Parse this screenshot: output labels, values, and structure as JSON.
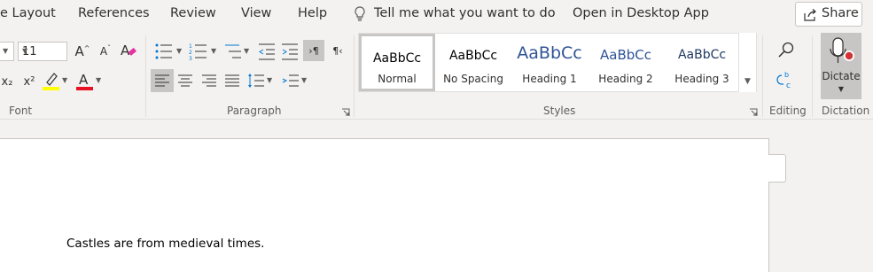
{
  "menu": {
    "items": [
      {
        "label": "e Layout"
      },
      {
        "label": "References"
      },
      {
        "label": "Review"
      },
      {
        "label": "View"
      },
      {
        "label": "Help"
      }
    ],
    "tell_me": "Tell me what you want to do",
    "open_desktop": "Open in Desktop App",
    "share": "Share"
  },
  "ribbon": {
    "font": {
      "size": "11",
      "label": "Font",
      "subscript_label": "x₂",
      "superscript_label": "x²",
      "grow": "A",
      "shrink": "A",
      "font_color": "A",
      "highlight_color": "#ffff00",
      "font_color_value": "#e81123"
    },
    "paragraph": {
      "label": "Paragraph"
    },
    "styles": {
      "label": "Styles",
      "items": [
        {
          "sample": "AaBbCc",
          "name": "Normal"
        },
        {
          "sample": "AaBbCc",
          "name": "No Spacing"
        },
        {
          "sample": "AaBbCc",
          "name": "Heading 1"
        },
        {
          "sample": "AaBbCc",
          "name": "Heading 2"
        },
        {
          "sample": "AaBbCc",
          "name": "Heading 3"
        }
      ],
      "heading_color": "#2f5496"
    },
    "editing": {
      "label": "Editing"
    },
    "dictation": {
      "label": "Dictation",
      "button": "Dictate"
    }
  },
  "document": {
    "body_text": "Castles are from medieval times."
  }
}
